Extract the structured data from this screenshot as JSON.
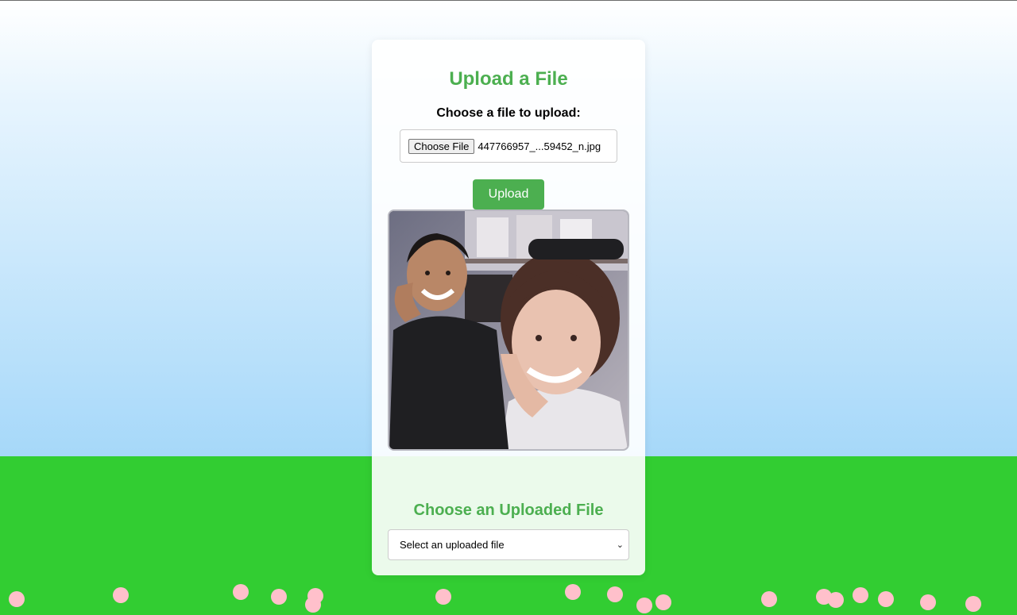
{
  "upload": {
    "title": "Upload a File",
    "file_label": "Choose a file to upload:",
    "choose_button": "Choose File",
    "file_name": "447766957_...59452_n.jpg",
    "upload_button": "Upload"
  },
  "preview": {
    "icon": "photo-preview"
  },
  "uploaded": {
    "title": "Choose an Uploaded File",
    "select_value": "Select an uploaded file",
    "chevron": "⌄"
  },
  "colors": {
    "accent": "#4caf50",
    "sky_top": "#ffffff",
    "sky_bottom": "#a6d8f9",
    "grass": "#32cd32",
    "flower": "#ffc0cb"
  }
}
